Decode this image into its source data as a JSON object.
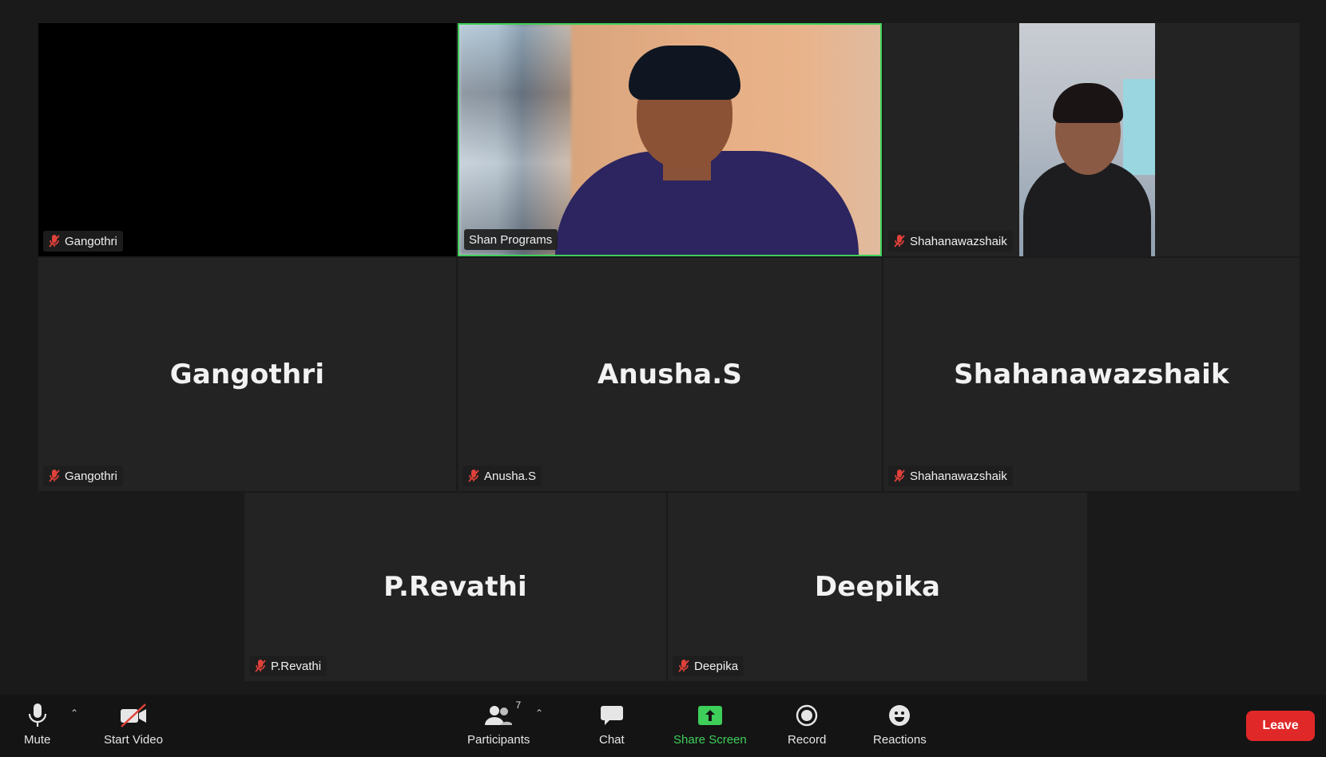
{
  "tiles": [
    {
      "id": "gangothri-video",
      "big_name": "",
      "label": "Gangothri",
      "muted": true
    },
    {
      "id": "shan-programs",
      "big_name": "",
      "label": "Shan Programs",
      "muted": false,
      "active_speaker": true
    },
    {
      "id": "shahanawazshaik-video",
      "big_name": "",
      "label": "Shahanawazshaik",
      "muted": true
    },
    {
      "id": "gangothri-2",
      "big_name": "Gangothri",
      "label": "Gangothri",
      "muted": true
    },
    {
      "id": "anusha",
      "big_name": "Anusha.S",
      "label": "Anusha.S",
      "muted": true
    },
    {
      "id": "shahanawazshaik-2",
      "big_name": "Shahanawazshaik",
      "label": "Shahanawazshaik",
      "muted": true
    },
    {
      "id": "revathi",
      "big_name": "P.Revathi",
      "label": "P.Revathi",
      "muted": true
    },
    {
      "id": "deepika",
      "big_name": "Deepika",
      "label": "Deepika",
      "muted": true
    }
  ],
  "toolbar": {
    "mute_label": "Mute",
    "start_video_label": "Start Video",
    "participants_label": "Participants",
    "participants_count": "7",
    "chat_label": "Chat",
    "share_screen_label": "Share Screen",
    "record_label": "Record",
    "reactions_label": "Reactions",
    "leave_label": "Leave"
  },
  "colors": {
    "active_border": "#3ecf5a",
    "muted_icon": "#e0413a",
    "leave_button": "#e02828",
    "share_green": "#3ecf5a"
  },
  "icons": [
    "mic-icon",
    "video-off-icon",
    "participants-icon",
    "chat-icon",
    "share-screen-icon",
    "record-icon",
    "reactions-icon",
    "muted-mic-icon",
    "caret-up-icon"
  ]
}
